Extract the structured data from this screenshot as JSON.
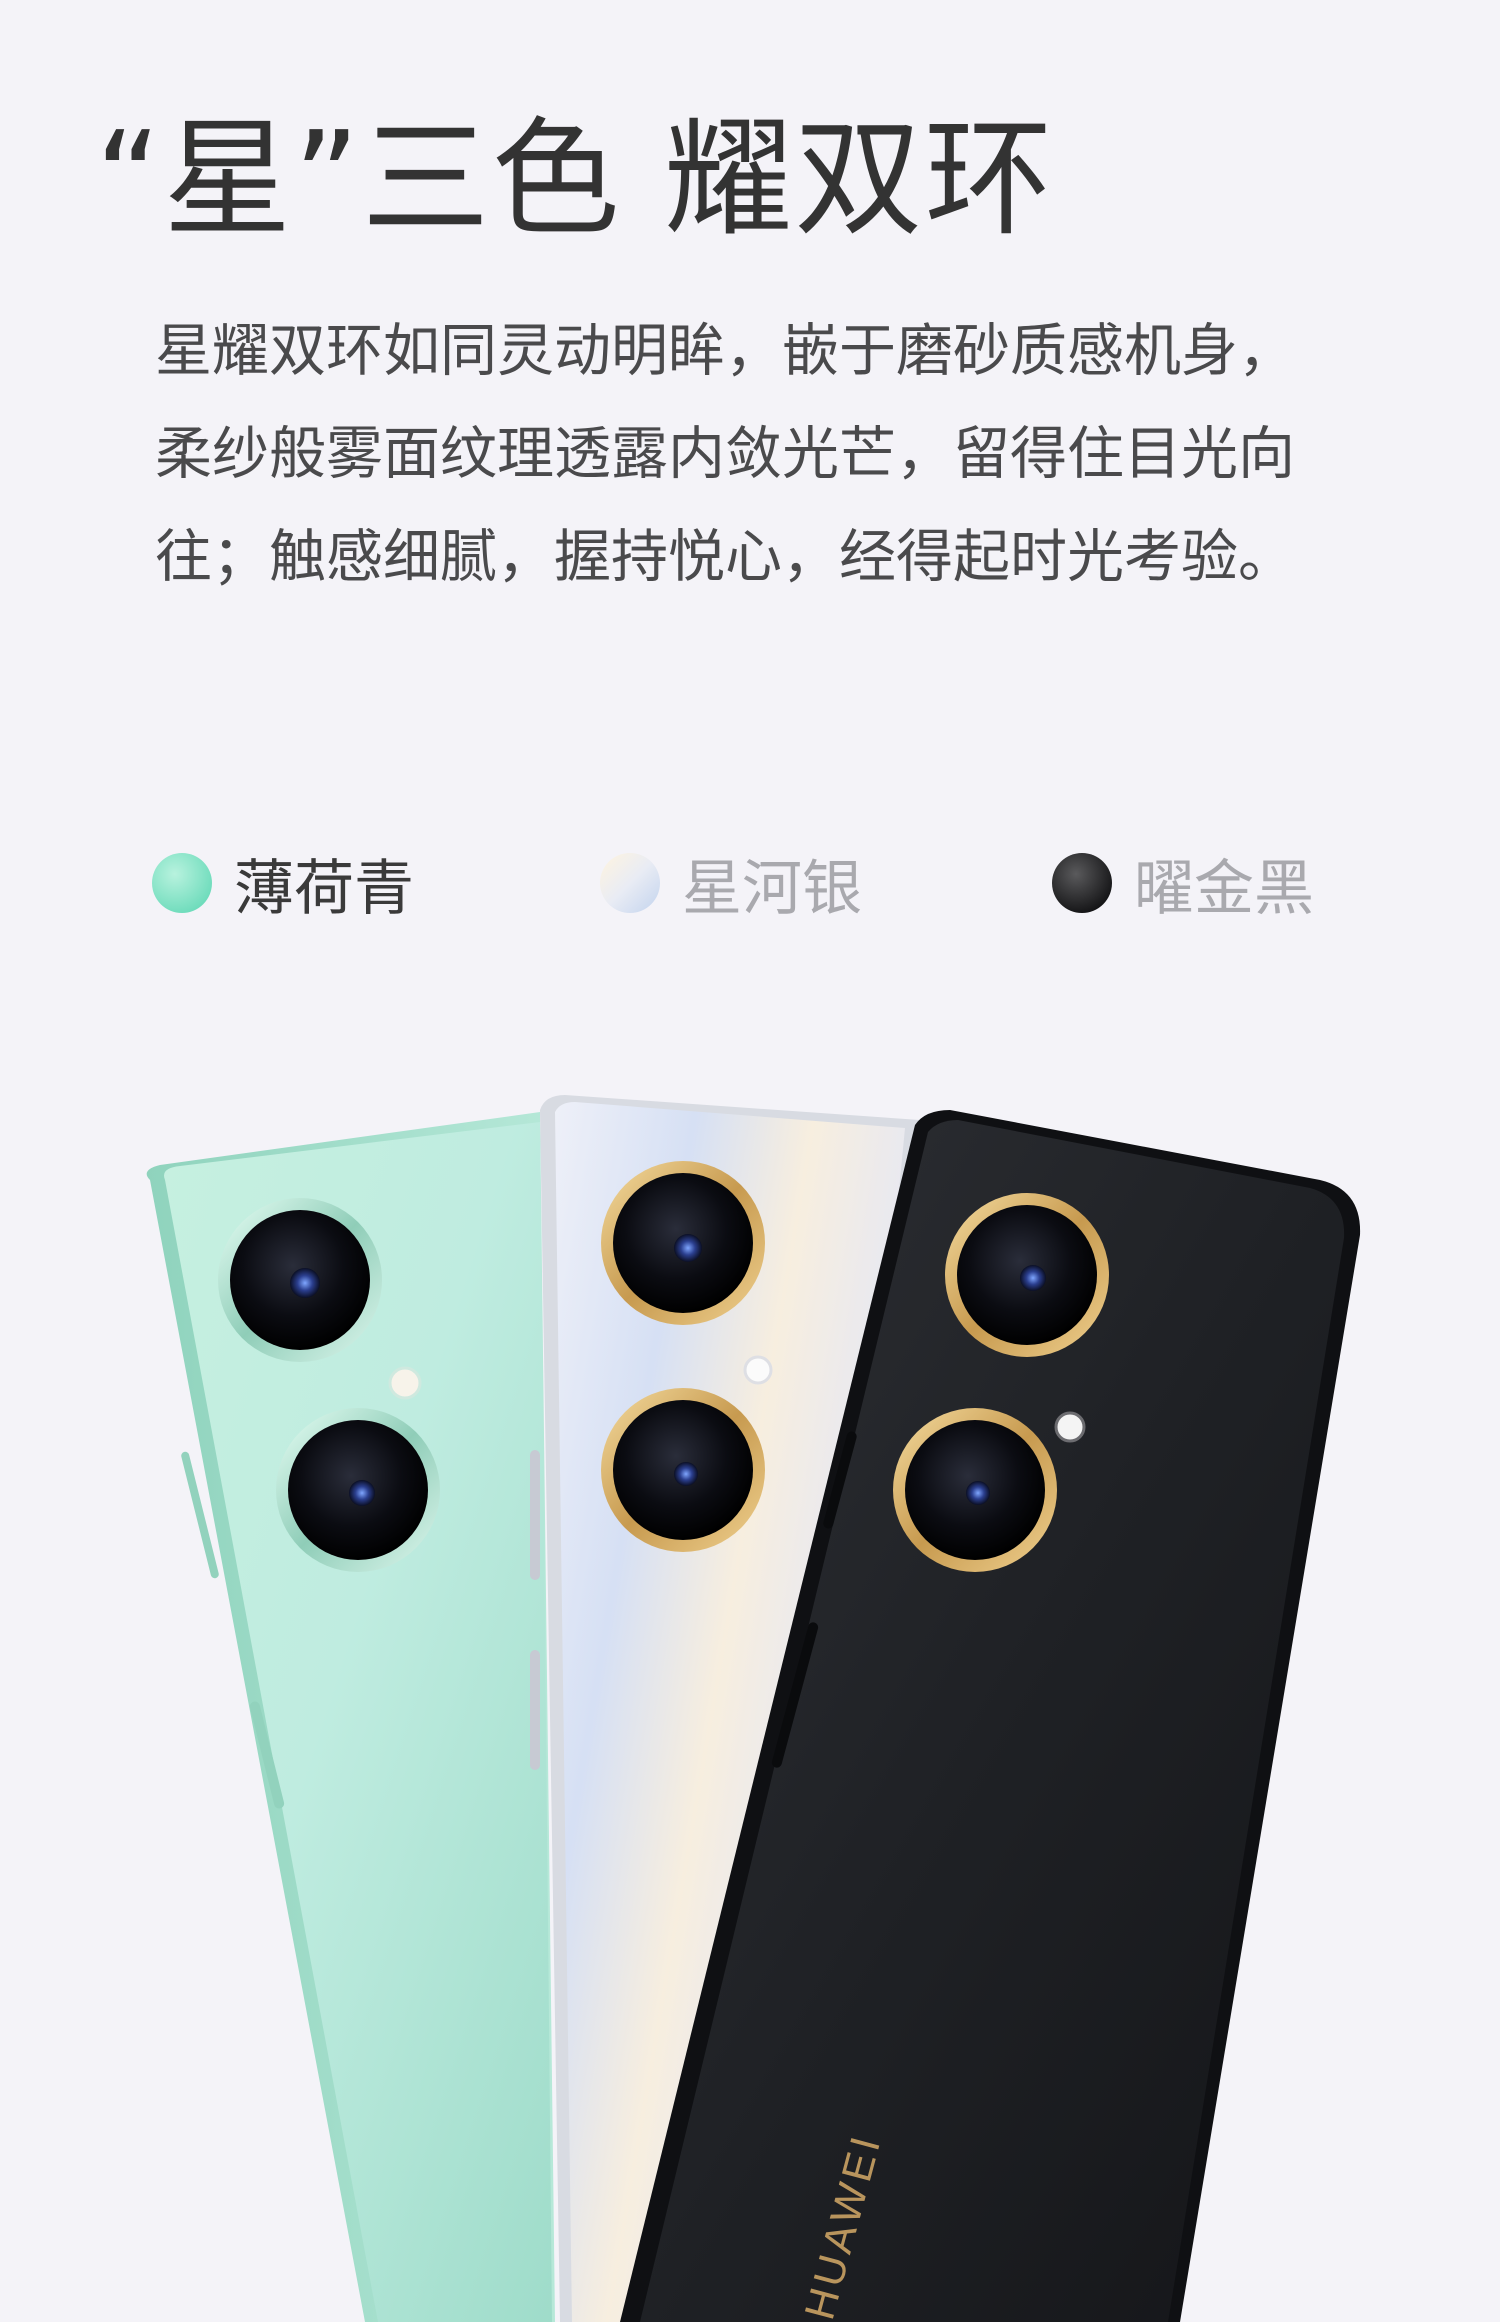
{
  "headline": "“星”三色 耀双环",
  "body": "星耀双环如同灵动明眸，嵌于磨砂质感机身，柔纱般雾面纹理透露内敛光芒，留得住目光向往；触感细腻，握持悦心，经得起时光考验。",
  "colors": [
    {
      "name": "薄荷青",
      "swatch": "#7ee0c2",
      "state": "selected"
    },
    {
      "name": "星河银",
      "swatch": "#dde3f0",
      "state": "unselected"
    },
    {
      "name": "曜金黑",
      "swatch": "#1e1e20",
      "state": "unselected"
    }
  ],
  "phone": {
    "brand": "HUAWEI"
  }
}
